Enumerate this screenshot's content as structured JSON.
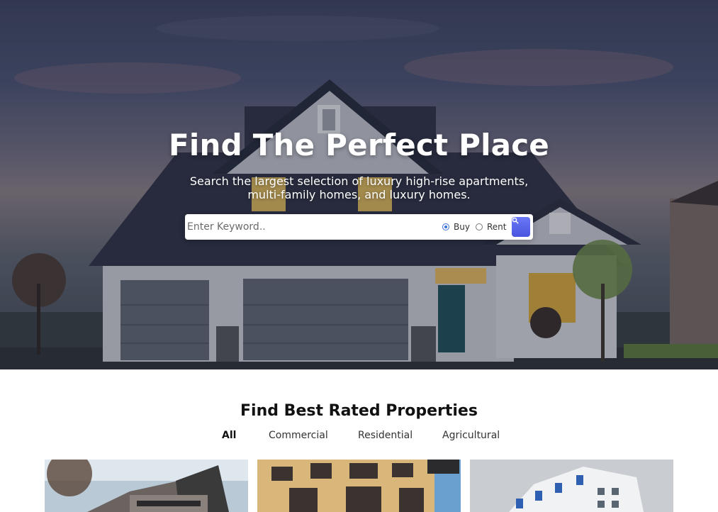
{
  "hero": {
    "title": "Find The Perfect Place",
    "subtitle_line1": "Search the largest selection of luxury high-rise apartments,",
    "subtitle_line2": "multi-family homes, and luxury homes."
  },
  "search": {
    "placeholder": "Enter Keyword..",
    "value": "",
    "options": [
      {
        "label": "Buy",
        "selected": true
      },
      {
        "label": "Rent",
        "selected": false
      }
    ],
    "button_icon": "search-icon"
  },
  "properties": {
    "title": "Find Best Rated Properties",
    "tabs": [
      {
        "label": "All",
        "active": true
      },
      {
        "label": "Commercial",
        "active": false
      },
      {
        "label": "Residential",
        "active": false
      },
      {
        "label": "Agricultural",
        "active": false
      }
    ]
  },
  "colors": {
    "accent": "#5763ea",
    "radio_checked": "#3b6fd8"
  }
}
